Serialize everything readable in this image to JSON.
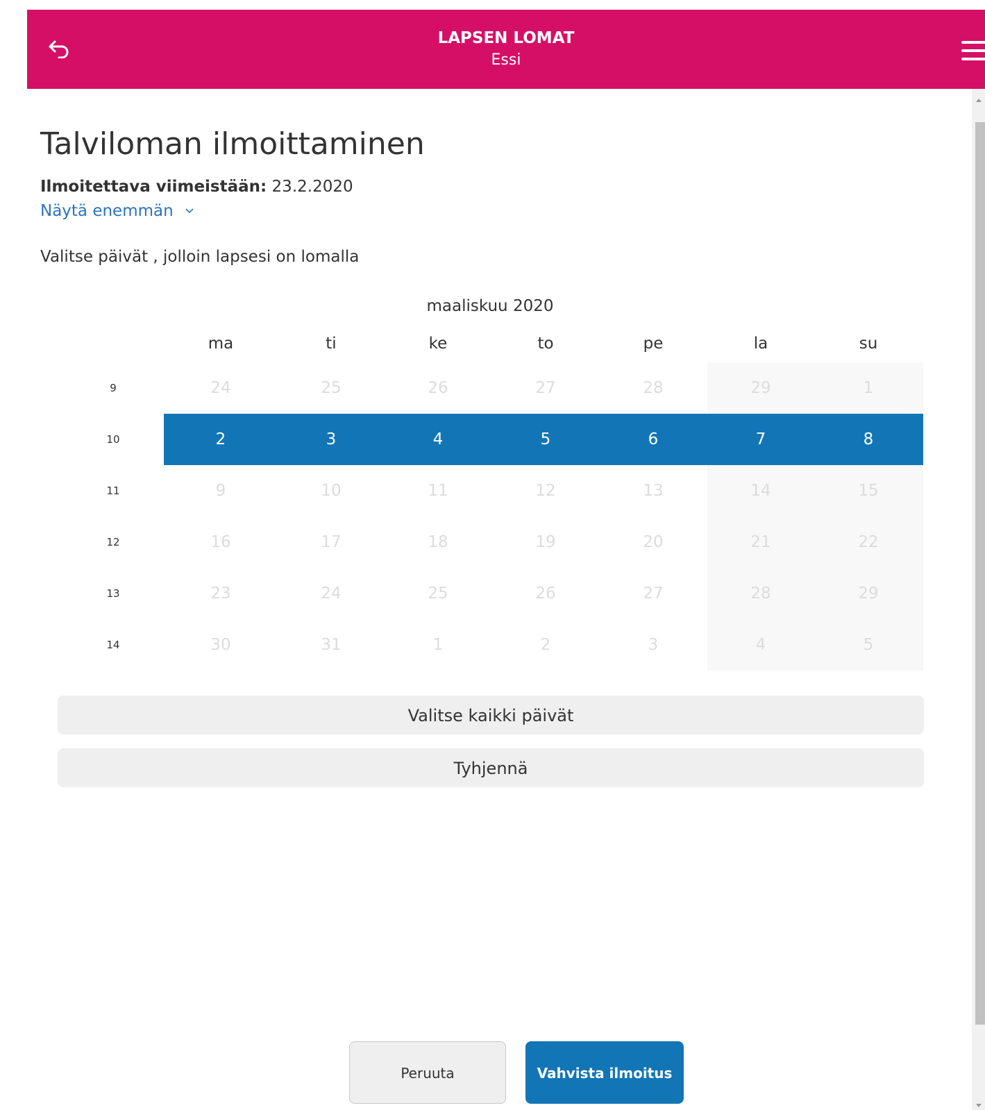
{
  "header": {
    "title": "LAPSEN LOMAT",
    "subtitle": "Essi",
    "back_icon": "back-arrow-icon",
    "menu_icon": "hamburger-menu-icon",
    "color": "#d50f66"
  },
  "page": {
    "title": "Talviloman ilmoittaminen",
    "deadline_label": "Ilmoitettava viimeistään:",
    "deadline_value": "23.2.2020",
    "show_more": "Näytä enemmän",
    "instruction": "Valitse päivät , jolloin lapsesi on lomalla"
  },
  "calendar": {
    "month": "maaliskuu 2020",
    "weekdays": [
      "ma",
      "ti",
      "ke",
      "to",
      "pe",
      "la",
      "su"
    ],
    "selected_color": "#1276b6",
    "weeks": [
      {
        "week": "9",
        "days": [
          "24",
          "25",
          "26",
          "27",
          "28",
          "29",
          "1"
        ],
        "selected": false
      },
      {
        "week": "10",
        "days": [
          "2",
          "3",
          "4",
          "5",
          "6",
          "7",
          "8"
        ],
        "selected": true
      },
      {
        "week": "11",
        "days": [
          "9",
          "10",
          "11",
          "12",
          "13",
          "14",
          "15"
        ],
        "selected": false
      },
      {
        "week": "12",
        "days": [
          "16",
          "17",
          "18",
          "19",
          "20",
          "21",
          "22"
        ],
        "selected": false
      },
      {
        "week": "13",
        "days": [
          "23",
          "24",
          "25",
          "26",
          "27",
          "28",
          "29"
        ],
        "selected": false
      },
      {
        "week": "14",
        "days": [
          "30",
          "31",
          "1",
          "2",
          "3",
          "4",
          "5"
        ],
        "selected": false
      }
    ]
  },
  "actions": {
    "select_all": "Valitse kaikki päivät",
    "clear": "Tyhjennä",
    "cancel": "Peruuta",
    "confirm": "Vahvista ilmoitus"
  }
}
